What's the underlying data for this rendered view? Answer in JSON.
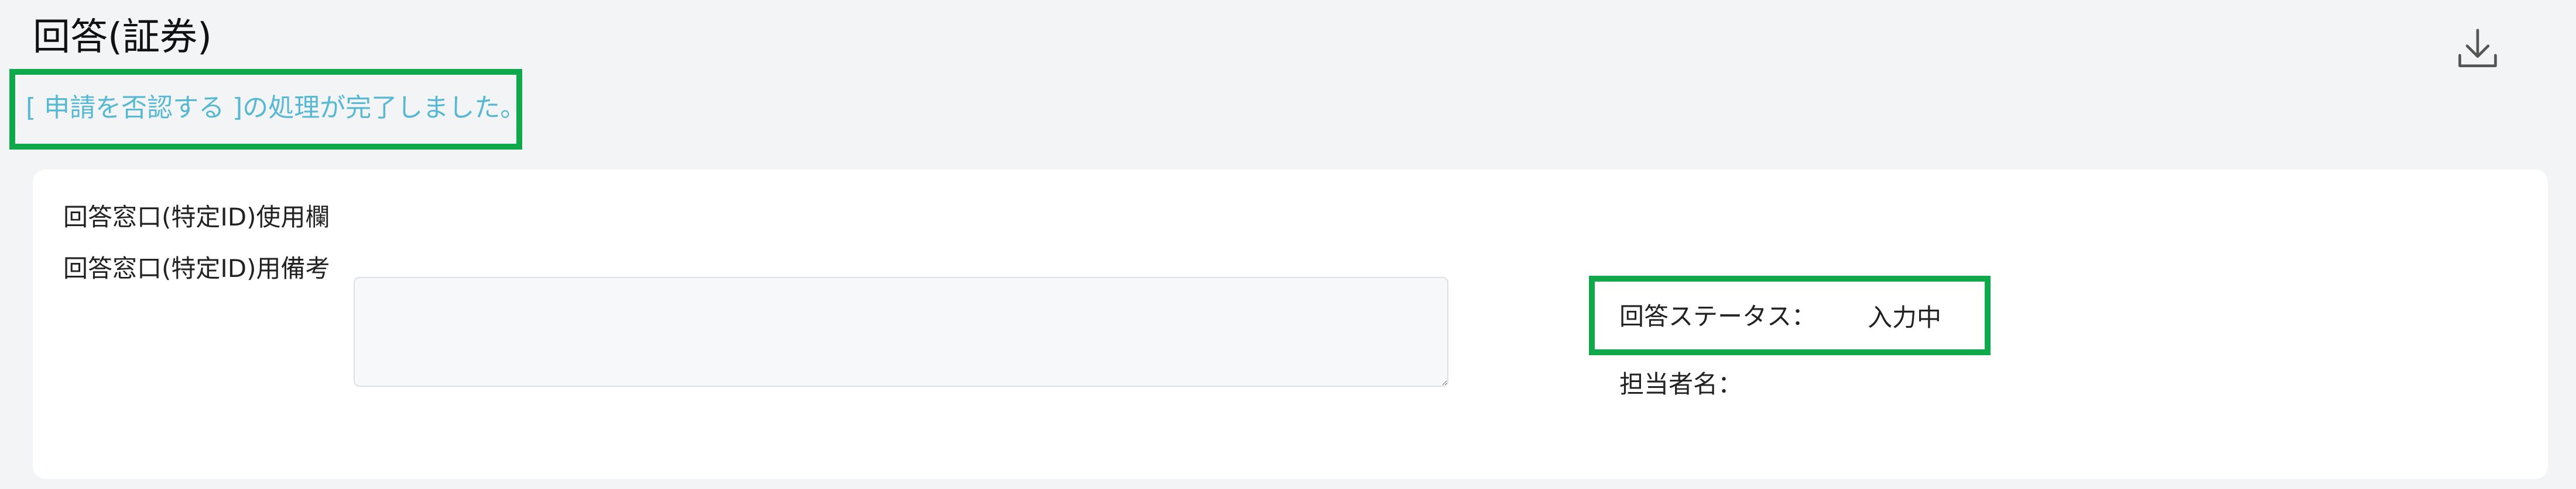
{
  "header": {
    "title": "回答(証券)"
  },
  "message": {
    "text": "[ 申請を否認する ]の処理が完了しました。"
  },
  "form": {
    "usage_label": "回答窓口(特定ID)使用欄",
    "remarks_label": "回答窓口(特定ID)用備考",
    "remarks_value": "",
    "status_label": "回答ステータス：",
    "status_value": "入力中",
    "assignee_label": "担当者名：",
    "assignee_value": ""
  },
  "icons": {
    "download": "download-icon"
  },
  "colors": {
    "background": "#f2f4f5",
    "card": "#ffffff",
    "highlight": "#0fa84a",
    "message": "#56b8d2"
  }
}
